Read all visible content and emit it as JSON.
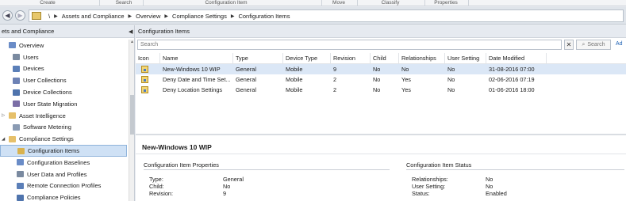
{
  "ribbon": {
    "groups": [
      "Create",
      "Search",
      "Configuration Item",
      "Move",
      "Classify",
      "Properties"
    ]
  },
  "nav": {
    "back_icon": "back-arrow-icon",
    "forward_icon": "forward-arrow-icon",
    "breadcrumb": [
      "\\",
      "Assets and Compliance",
      "Overview",
      "Compliance Settings",
      "Configuration Items"
    ]
  },
  "left_pane": {
    "title": "ets and Compliance",
    "items": [
      {
        "label": "Overview",
        "icon": "overview-icon",
        "color": "#6a8cc7",
        "indent": 0,
        "expander": ""
      },
      {
        "label": "Users",
        "icon": "user-icon",
        "color": "#7a8aa0",
        "indent": 1,
        "expander": ""
      },
      {
        "label": "Devices",
        "icon": "device-icon",
        "color": "#5b7fb8",
        "indent": 1,
        "expander": ""
      },
      {
        "label": "User Collections",
        "icon": "user-collection-icon",
        "color": "#6d82b5",
        "indent": 1,
        "expander": ""
      },
      {
        "label": "Device Collections",
        "icon": "device-collection-icon",
        "color": "#4f74ad",
        "indent": 1,
        "expander": ""
      },
      {
        "label": "User State Migration",
        "icon": "migration-icon",
        "color": "#7b6ea6",
        "indent": 1,
        "expander": ""
      },
      {
        "label": "Asset Intelligence",
        "icon": "folder-icon",
        "color": "#e6c06a",
        "indent": 0,
        "expander": "▷"
      },
      {
        "label": "Software Metering",
        "icon": "metering-icon",
        "color": "#8a9bb3",
        "indent": 1,
        "expander": ""
      },
      {
        "label": "Compliance Settings",
        "icon": "folder-icon",
        "color": "#e6c06a",
        "indent": 0,
        "expander": "◢"
      },
      {
        "label": "Configuration Items",
        "icon": "configuration-item-icon",
        "color": "#d9b24e",
        "indent": 2,
        "expander": "",
        "selected": true
      },
      {
        "label": "Configuration Baselines",
        "icon": "baseline-icon",
        "color": "#6a8cc7",
        "indent": 2,
        "expander": ""
      },
      {
        "label": "User Data and Profiles",
        "icon": "profile-icon",
        "color": "#7a8aa0",
        "indent": 2,
        "expander": ""
      },
      {
        "label": "Remote Connection Profiles",
        "icon": "remote-icon",
        "color": "#5b7fb8",
        "indent": 2,
        "expander": ""
      },
      {
        "label": "Compliance Policies",
        "icon": "policy-icon",
        "color": "#4f74ad",
        "indent": 2,
        "expander": ""
      }
    ]
  },
  "right_pane": {
    "title": "Configuration Items",
    "search": {
      "placeholder": "Search",
      "clear_label": "✕",
      "button_label": "Search",
      "add_label": "Ad"
    },
    "columns": [
      "Icon",
      "Name",
      "Type",
      "Device Type",
      "Revision",
      "Child",
      "Relationships",
      "User Setting",
      "Date Modified"
    ],
    "rows": [
      {
        "name": "New-Windows 10 WIP",
        "type": "General",
        "device_type": "Mobile",
        "revision": "9",
        "child": "No",
        "relationships": "No",
        "user_setting": "No",
        "date_modified": "31-08-2016 07:00",
        "selected": true
      },
      {
        "name": "Deny Date and Time Set...",
        "type": "General",
        "device_type": "Mobile",
        "revision": "2",
        "child": "No",
        "relationships": "Yes",
        "user_setting": "No",
        "date_modified": "02-06-2016 07:19",
        "selected": false
      },
      {
        "name": "Deny Location Settings",
        "type": "General",
        "device_type": "Mobile",
        "revision": "2",
        "child": "No",
        "relationships": "Yes",
        "user_setting": "No",
        "date_modified": "01-06-2016 18:00",
        "selected": false
      }
    ]
  },
  "details": {
    "title": "New-Windows 10 WIP",
    "properties_title": "Configuration Item Properties",
    "properties": [
      {
        "label": "Type:",
        "value": "General"
      },
      {
        "label": "Child:",
        "value": "No"
      },
      {
        "label": "Revision:",
        "value": "9"
      }
    ],
    "status_title": "Configuration Item Status",
    "status": [
      {
        "label": "Relationships:",
        "value": "No"
      },
      {
        "label": "User Setting:",
        "value": "No"
      },
      {
        "label": "Status:",
        "value": "Enabled"
      }
    ]
  }
}
